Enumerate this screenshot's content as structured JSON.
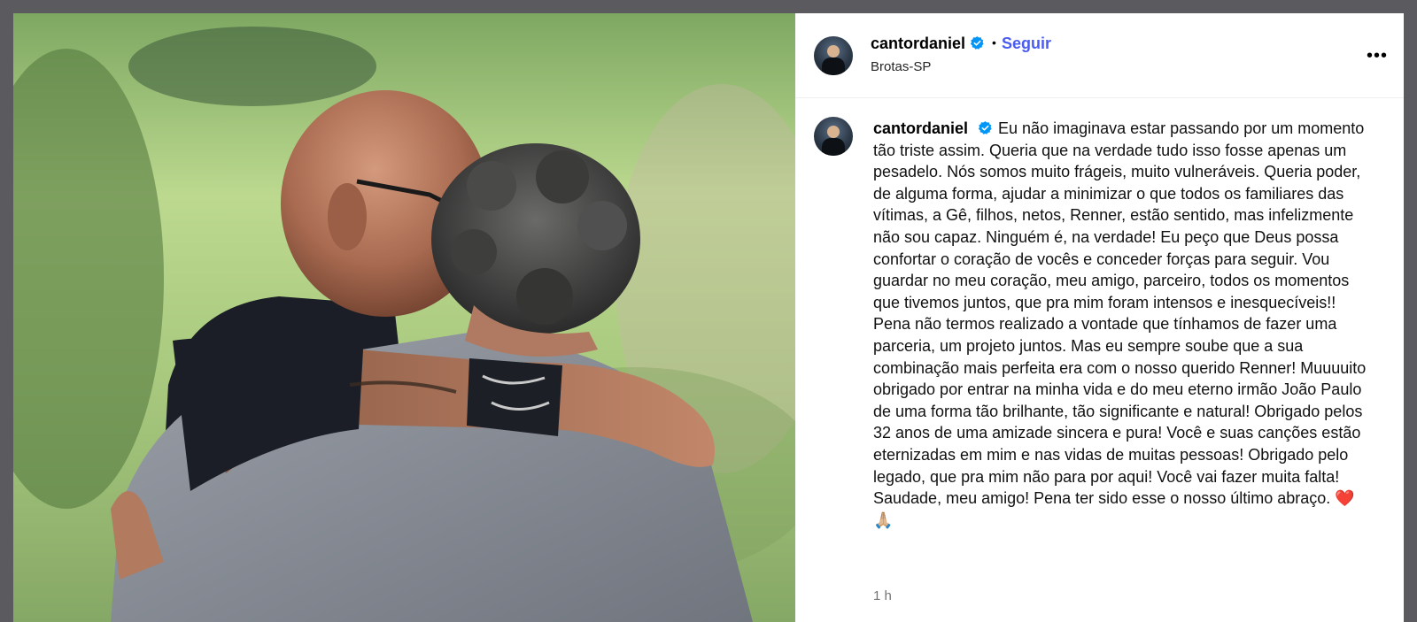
{
  "post": {
    "username": "cantordaniel",
    "follow_label": "Seguir",
    "separator": "•",
    "location": "Brotas-SP",
    "more_label": "•••",
    "photo_alt": "Dois homens se abraçando",
    "caption_text": "Eu não imaginava estar passando por um momento tão triste assim. Queria que na verdade tudo isso fosse apenas um pesadelo. Nós somos muito frágeis, muito vulneráveis. Queria poder, de alguma forma, ajudar a minimizar o que todos os familiares das vítimas, a Gê, filhos, netos, Renner, estão sentido, mas infelizmente não sou capaz. Ninguém é, na verdade! Eu peço que Deus possa confortar o coração de vocês e conceder forças para seguir. Vou guardar no meu coração, meu amigo, parceiro, todos os momentos que tivemos juntos, que pra mim foram intensos e inesquecíveis!! Pena não termos realizado a vontade que tínhamos de fazer uma parceria, um projeto juntos. Mas eu sempre soube que a sua combinação mais perfeita era com o nosso querido Renner! Muuuuito obrigado por entrar na minha vida e do meu eterno irmão João Paulo de uma forma tão brilhante, tão significante e natural! Obrigado pelos 32 anos de uma amizade sincera e pura! Você e suas canções estão eternizadas em mim e nas vidas de muitas pessoas! Obrigado pelo legado, que pra mim não para por aqui! Você vai fazer muita falta! Saudade, meu amigo! Pena ter sido esse o nosso último abraço. ❤️🙏🏼",
    "timestamp": "1 h"
  },
  "colors": {
    "follow": "#4a5cf0",
    "verified": "#0095f6",
    "backdrop": "#5b5b5f"
  }
}
